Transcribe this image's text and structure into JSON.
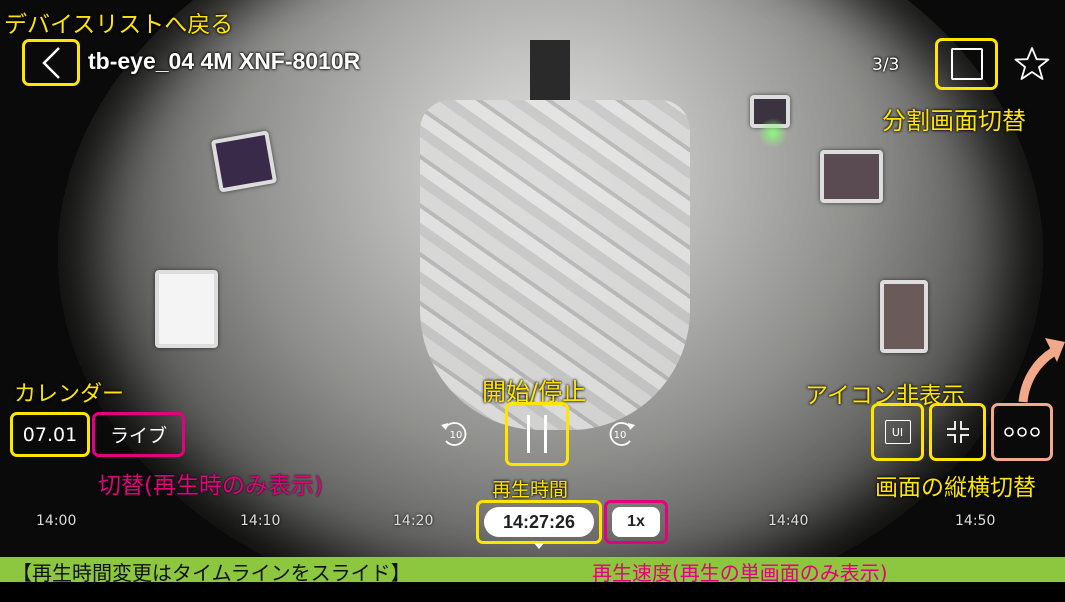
{
  "header": {
    "back_annotation": "デバイスリストへ戻る",
    "device_title": "tb-eye_04 4M XNF-8010R",
    "page_counter": "3/3",
    "split_annotation": "分割画面切替"
  },
  "controls": {
    "date": "07.01",
    "calendar_annotation": "カレンダー",
    "live_button": "ライブ",
    "live_annotation": "切替(再生時のみ表示)",
    "play_pause_annotation": "開始/停止",
    "rewind_label": "10",
    "forward_label": "10",
    "ui_button": "UI",
    "icons_annotation": "アイコン非表示",
    "orientation_annotation": "画面の縦横切替"
  },
  "timeline": {
    "ticks": [
      "14:00",
      "14:10",
      "14:20",
      "14:40",
      "14:50"
    ],
    "current_time": "14:27:26",
    "current_time_annotation": "再生時間",
    "speed": "1x"
  },
  "footer": {
    "timeline_hint": "【再生時間変更はタイムラインをスライド】",
    "speed_annotation": "再生速度(再生の単画面のみ表示)"
  },
  "colors": {
    "annotation_yellow": "#ffe600",
    "annotation_pink": "#e5007e",
    "hint_bar_green": "#8dc63f"
  }
}
